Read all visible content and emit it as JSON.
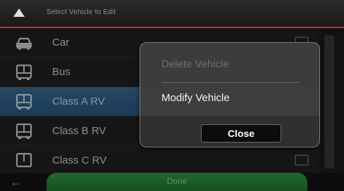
{
  "header": {
    "title": "Select Vehicle to Edit"
  },
  "vehicles": [
    {
      "label": "Car",
      "icon": "car-icon"
    },
    {
      "label": "Bus",
      "icon": "bus-icon"
    },
    {
      "label": "Class A RV",
      "icon": "rv-icon",
      "selected": true
    },
    {
      "label": "Class B RV",
      "icon": "rv-icon"
    },
    {
      "label": "Class C RV",
      "icon": "rv-icon"
    }
  ],
  "footer": {
    "done_label": "Done",
    "back_glyph": "←"
  },
  "dialog": {
    "delete_label": "Delete Vehicle",
    "modify_label": "Modify Vehicle",
    "close_label": "Close"
  },
  "colors": {
    "accent_red": "#c0312e",
    "selected_blue": "#2b5c85",
    "done_green": "#2a8d3f"
  }
}
